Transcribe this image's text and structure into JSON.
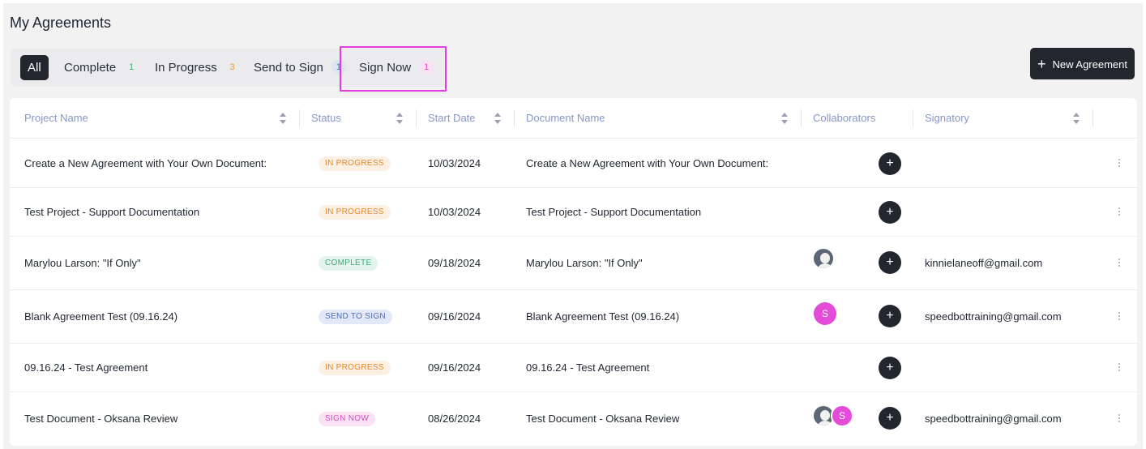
{
  "page": {
    "title": "My Agreements"
  },
  "tabs": [
    {
      "label": "All",
      "count": ""
    },
    {
      "label": "Complete",
      "count": "1"
    },
    {
      "label": "In Progress",
      "count": "3"
    },
    {
      "label": "Send to Sign",
      "count": "1"
    },
    {
      "label": "Sign Now",
      "count": "1"
    }
  ],
  "toolbar": {
    "new_agreement_label": "New Agreement"
  },
  "table": {
    "columns": [
      "Project Name",
      "Status",
      "Start Date",
      "Document Name",
      "Collaborators",
      "Signatory"
    ],
    "rows": [
      {
        "project": "Create a New Agreement with Your Own Document:",
        "status": "IN PROGRESS",
        "date": "10/03/2024",
        "document": "Create a New Agreement with Your Own Document:",
        "signatory": ""
      },
      {
        "project": "Test Project - Support Documentation",
        "status": "IN PROGRESS",
        "date": "10/03/2024",
        "document": "Test Project - Support Documentation",
        "signatory": ""
      },
      {
        "project": "Marylou Larson: \"If Only\"",
        "status": "COMPLETE",
        "date": "09/18/2024",
        "document": "Marylou Larson: \"If Only\"",
        "signatory": "kinnielaneoff@gmail.com"
      },
      {
        "project": "Blank Agreement Test (09.16.24)",
        "status": "SEND TO SIGN",
        "date": "09/16/2024",
        "document": "Blank Agreement Test (09.16.24)",
        "signatory": "speedbottraining@gmail.com"
      },
      {
        "project": "09.16.24 - Test Agreement",
        "status": "IN PROGRESS",
        "date": "09/16/2024",
        "document": "09.16.24 - Test Agreement",
        "signatory": ""
      },
      {
        "project": "Test Document - Oksana Review",
        "status": "SIGN NOW",
        "date": "08/26/2024",
        "document": "Test Document - Oksana Review",
        "signatory": "speedbottraining@gmail.com"
      }
    ],
    "avatar_initial": "S",
    "add_symbol": "+"
  },
  "colors": {
    "accent_dark": "#22272f",
    "highlight": "#e43ce0",
    "in_progress": "#e0892f",
    "complete": "#3fa779",
    "send_to_sign": "#4e6db4",
    "sign_now": "#d84bbe"
  }
}
